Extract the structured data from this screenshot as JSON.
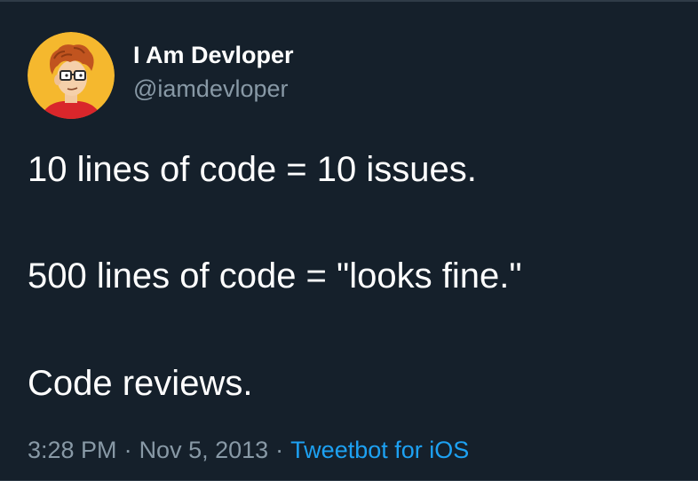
{
  "author": {
    "display_name": "I Am Devloper",
    "handle": "@iamdevloper",
    "avatar_icon": "cartoon-developer-avatar"
  },
  "tweet": {
    "lines": [
      "10 lines of code = 10 issues.",
      "500 lines of code = \"looks fine.\"",
      "Code reviews."
    ]
  },
  "meta": {
    "time": "3:28 PM",
    "separator": "·",
    "date": "Nov 5, 2013",
    "source": "Tweetbot for iOS"
  },
  "colors": {
    "background": "#15202b",
    "text": "#ffffff",
    "secondary": "#8899a6",
    "link": "#1da1f2",
    "avatar_bg": "#f5b82e"
  }
}
